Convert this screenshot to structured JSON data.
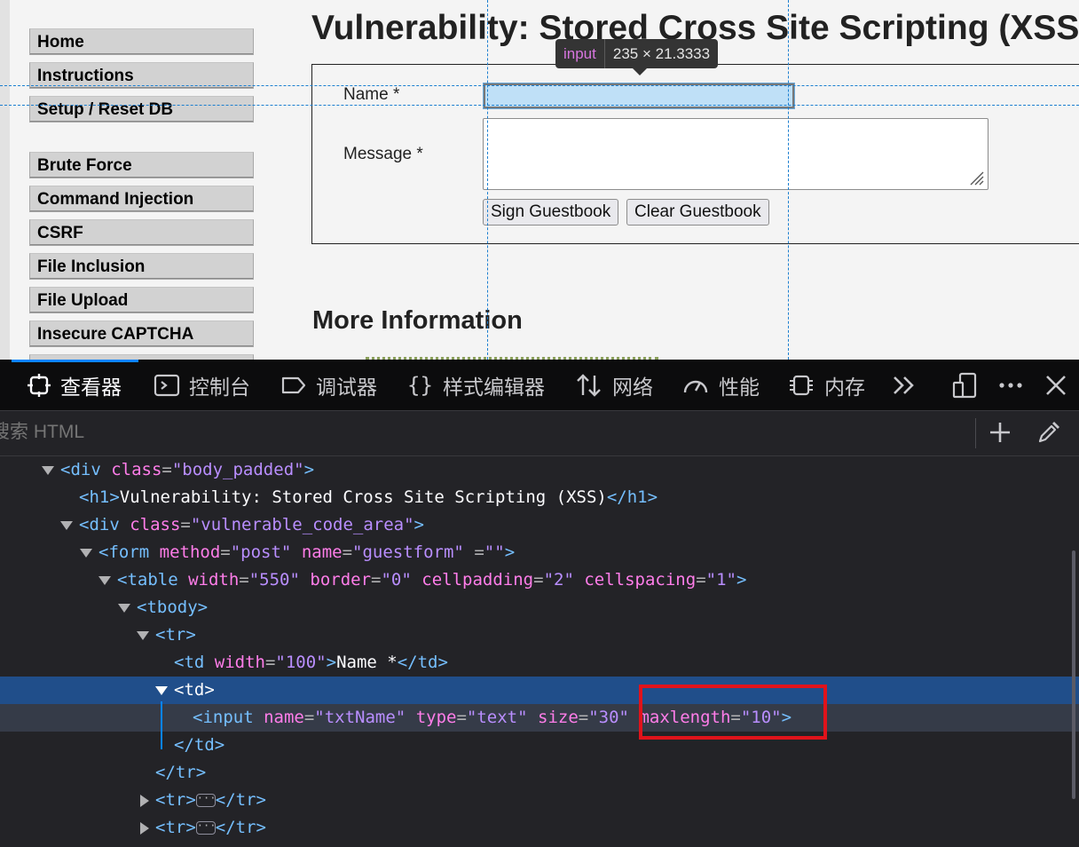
{
  "menu": {
    "group1": [
      "Home",
      "Instructions",
      "Setup / Reset DB"
    ],
    "group2": [
      "Brute Force",
      "Command Injection",
      "CSRF",
      "File Inclusion",
      "File Upload",
      "Insecure CAPTCHA"
    ]
  },
  "page": {
    "title": "Vulnerability: Stored Cross Site Scripting (XSS)",
    "name_label": "Name *",
    "message_label": "Message *",
    "sign_button": "Sign Guestbook",
    "clear_button": "Clear Guestbook",
    "more_info": "More Information"
  },
  "tooltip": {
    "tag": "input",
    "size": "235 × 21.3333"
  },
  "devtools": {
    "tabs": [
      "查看器",
      "控制台",
      "调试器",
      "样式编辑器",
      "网络",
      "性能",
      "内存"
    ],
    "search_placeholder": "搜索 HTML",
    "tree": {
      "h1_text": "Vulnerability: Stored Cross Site Scripting (XSS)",
      "td_name_text": "Name *",
      "body_padded_class": "\"body_padded\"",
      "vuln_class": "\"vulnerable_code_area\"",
      "form_method": "\"post\"",
      "form_name": "\"guestform\"",
      "form_empty_attr": "\"\"",
      "table_width": "\"550\"",
      "table_border": "\"0\"",
      "table_cellpadding": "\"2\"",
      "table_cellspacing": "\"1\"",
      "td_width": "\"100\"",
      "input_name": "\"txtName\"",
      "input_type": "\"text\"",
      "input_size": "\"30\"",
      "input_maxlength": "\"10\""
    }
  },
  "colors": {
    "selected_row": "#204e8a",
    "highlight_box": "#e0131b",
    "tab_active": "#0a84ff"
  }
}
